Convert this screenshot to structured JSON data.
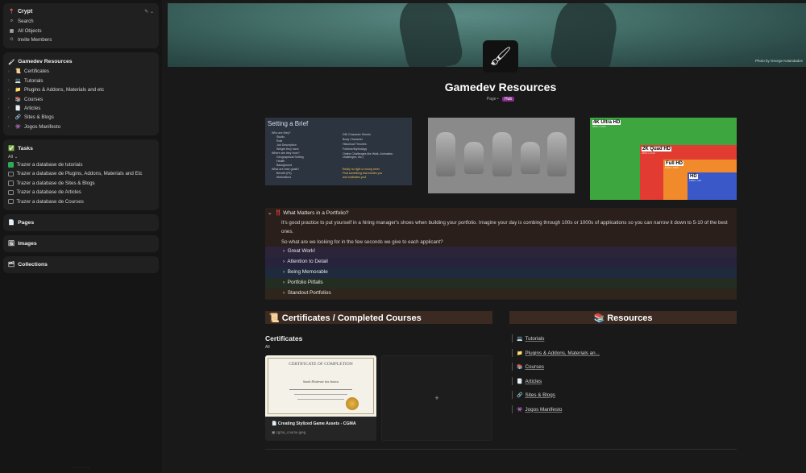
{
  "sidebar": {
    "workspace": {
      "icon": "📍",
      "name": "Crypt",
      "items": [
        {
          "icon": "⌕",
          "label": "Search"
        },
        {
          "icon": "▦",
          "label": "All Objects"
        },
        {
          "icon": "☺",
          "label": "Invite Members"
        }
      ]
    },
    "gamedev": {
      "icon": "🖌",
      "title": "Gamedev Resources",
      "items": [
        {
          "icon": "📜",
          "label": "Certificates"
        },
        {
          "icon": "💻",
          "label": "Tutorials"
        },
        {
          "icon": "📁",
          "label": "Plugins & Addons, Materials and etc"
        },
        {
          "icon": "📚",
          "label": "Courses"
        },
        {
          "icon": "📑",
          "label": "Articles"
        },
        {
          "icon": "🔗",
          "label": "Sites & Blogs"
        },
        {
          "icon": "👾",
          "label": "Jogos Manifesto"
        }
      ]
    },
    "tasks": {
      "icon": "✅",
      "title": "Tasks",
      "filter": "All",
      "items": [
        {
          "label": "Trazer a database de tutoriais",
          "checked": true
        },
        {
          "label": "Trazer a database de Plugins, Addons, Materials and Etc",
          "checked": false
        },
        {
          "label": "Trazer a database de Sites & Blogs",
          "checked": false
        },
        {
          "label": "Trazer a database de Articles",
          "checked": false
        },
        {
          "label": "Trazer a database de Courses",
          "checked": false
        }
      ]
    },
    "pages": {
      "icon": "📄",
      "title": "Pages"
    },
    "images": {
      "icon": "🖼",
      "title": "Images"
    },
    "collections": {
      "icon": "🗂",
      "title": "Collections"
    }
  },
  "page": {
    "icon": "🖌",
    "title": "Gamedev Resources",
    "type": "Page",
    "tag": "Hub",
    "cover_credit": "Photo by George Kalandadze"
  },
  "brief": {
    "title": "Setting a Brief",
    "left": [
      "Who are they?",
      "Studio",
      "Role",
      "Job Description",
      "Weight they have",
      "Where are they from?",
      "Geographical Setting",
      "Health",
      "Background",
      "What are their goals?",
      "Benefit (Fit)",
      "Motivations"
    ],
    "right": [
      "DB/ Character Sheets",
      "Body Character",
      "Historical Theories",
      "Folklore/Mythology",
      "Online Challenges like Walk, Animation challenges, etc.)"
    ],
    "note": [
      "Really no right or wrong here!",
      "Find something that excites you",
      "and motivates you!"
    ]
  },
  "resolution": [
    {
      "label": "4K",
      "strong": "Ultra HD",
      "px": "3840 x 2160"
    },
    {
      "label": "2K",
      "strong": "Quad HD",
      "px": "2560 x 1440"
    },
    {
      "label": "Full",
      "strong": "HD",
      "px": "1920 x 1080"
    },
    {
      "label": "HD",
      "strong": "",
      "px": "1280 x 720"
    }
  ],
  "toggle": {
    "title": "‼️ What Matters in a Portfolio?",
    "p1": "It's good practice to put yourself in a hiring manager's shoes when building your portfolio. Imagine your day is combing through 100s or 1000s of applications so you can narrow it down to 5-10 of the best ones.",
    "p2": "So what are we looking for in the few seconds we give to each applicant?",
    "items": [
      "Great Work!",
      "Attention to Detail",
      "Being Memorable",
      "Portfolio Pitfalls",
      "Standout Portfolios"
    ]
  },
  "certificates": {
    "heading": "📜 Certificates / Completed Courses",
    "subtitle": "Certificates",
    "filter": "All",
    "card": {
      "name": "Creating Stylized Game Assets - CGMA",
      "file": "cgma_course.jpeg",
      "cert_title": "CERTIFICATE OF COMPLETION",
      "cert_name": "Sarah Moderate dos Santos"
    },
    "add": "+"
  },
  "resources": {
    "heading": "📚 Resources",
    "links": [
      {
        "icon": "💻",
        "label": "Tutorials"
      },
      {
        "icon": "📁",
        "label": "Plugins & Addons, Materials an..."
      },
      {
        "icon": "📚",
        "label": "Courses"
      },
      {
        "icon": "📑",
        "label": "Articles"
      },
      {
        "icon": "🔗",
        "label": "Sites & Blogs"
      },
      {
        "icon": "👾",
        "label": "Jogos Manifesto"
      }
    ]
  }
}
